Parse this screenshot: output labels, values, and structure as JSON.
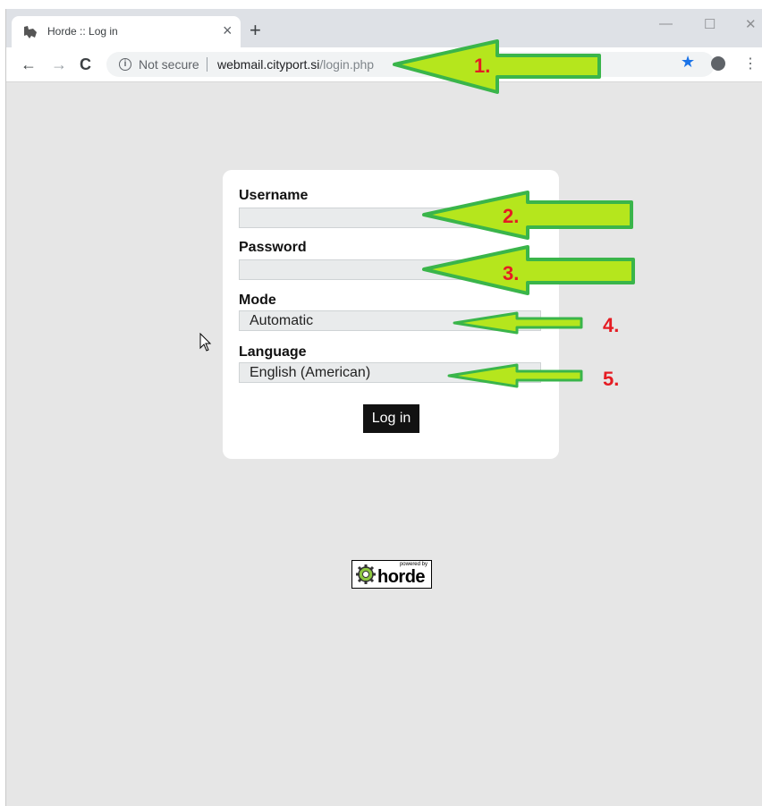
{
  "browser": {
    "tab_title": "Horde :: Log in",
    "tab_close": "×",
    "new_tab": "+",
    "window_controls": {
      "minimize": "—",
      "maximize": "☐",
      "close": "✕"
    },
    "nav": {
      "back": "←",
      "forward": "→",
      "reload": "C"
    },
    "security_label": "Not secure",
    "url_host": "webmail.cityport.si",
    "url_path": "/login.php",
    "menu": "⋮"
  },
  "login_form": {
    "username_label": "Username",
    "username_value": "",
    "password_label": "Password",
    "password_value": "",
    "mode_label": "Mode",
    "mode_value": "Automatic",
    "language_label": "Language",
    "language_value": "English (American)",
    "login_button": "Log in"
  },
  "footer": {
    "logo_powered": "powered by",
    "logo_text": "horde"
  },
  "annotations": {
    "numbers": [
      "1.",
      "2.",
      "3.",
      "4.",
      "5."
    ],
    "arrow_fill": "#b5e61d",
    "arrow_stroke": "#3ab54a",
    "number_color": "#e51c23"
  }
}
